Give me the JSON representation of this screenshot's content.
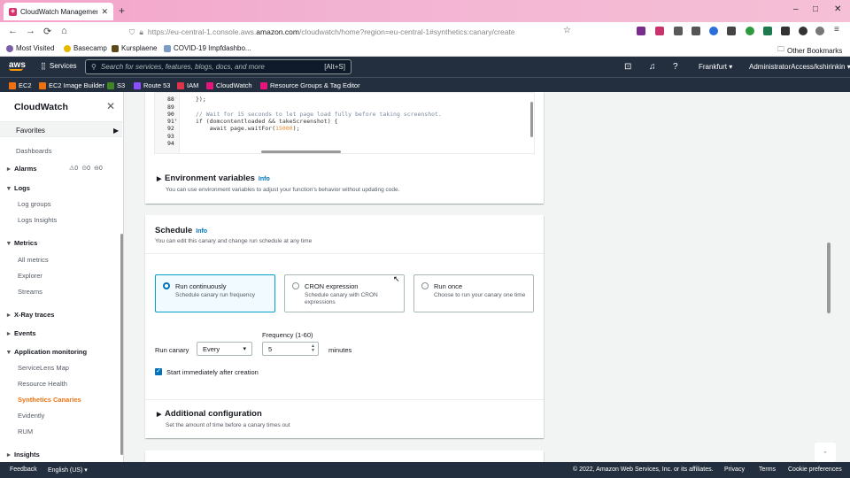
{
  "browser": {
    "tab_title": "CloudWatch Management",
    "new_tab": "+",
    "url_prefix": "https://eu-central-1.console.aws.",
    "url_host": "amazon.com",
    "url_path": "/cloudwatch/home?region=eu-central-1#synthetics:canary/create",
    "bookmarks": [
      "Most Visited",
      "Basecamp",
      "Kursplaene",
      "COVID-19 Impfdashbo..."
    ],
    "other_bookmarks": "Other Bookmarks"
  },
  "aws_header": {
    "logo": "aws",
    "services": "Services",
    "search_placeholder": "Search for services, features, blogs, docs, and more",
    "search_shortcut": "[Alt+S]",
    "region": "Frankfurt",
    "account": "AdministratorAccess/kshirinkin"
  },
  "favorites_bar": [
    "EC2",
    "EC2 Image Builder",
    "S3",
    "Route 53",
    "IAM",
    "CloudWatch",
    "Resource Groups & Tag Editor"
  ],
  "favorites_colors": [
    "#ec7211",
    "#ec7211",
    "#3f8624",
    "#8c4fff",
    "#dd344c",
    "#e7157b",
    "#e7157b"
  ],
  "sidebar": {
    "title": "CloudWatch",
    "favorites": "Favorites",
    "dashboards": "Dashboards",
    "alarms": "Alarms",
    "alarm_counts": [
      "0",
      "0",
      "0"
    ],
    "logs": "Logs",
    "log_groups": "Log groups",
    "logs_insights": "Logs Insights",
    "metrics": "Metrics",
    "all_metrics": "All metrics",
    "explorer": "Explorer",
    "streams": "Streams",
    "xray": "X-Ray traces",
    "events": "Events",
    "app_monitoring": "Application monitoring",
    "servicelens": "ServiceLens Map",
    "resource_health": "Resource Health",
    "synthetics": "Synthetics Canaries",
    "evidently": "Evidently",
    "rum": "RUM",
    "insights": "Insights"
  },
  "code": {
    "lines": [
      {
        "n": "88",
        "t": "});"
      },
      {
        "n": "89",
        "t": ""
      },
      {
        "n": "90",
        "t": "// Wait for 15 seconds to let page load fully before taking screenshot."
      },
      {
        "n": "91",
        "t": "if (domcontentloaded && takeScreenshot) {"
      },
      {
        "n": "92",
        "t": "    await page.waitFor(",
        "num": "15000",
        "tail": ");"
      },
      {
        "n": "93",
        "t": ""
      },
      {
        "n": "94",
        "t": ""
      }
    ]
  },
  "env": {
    "title": "Environment variables",
    "info": "Info",
    "desc": "You can use environment variables to adjust your function's behavior without updating code."
  },
  "schedule": {
    "title": "Schedule",
    "info": "Info",
    "desc": "You can edit this canary and change run schedule at any time",
    "options": [
      {
        "label": "Run continuously",
        "desc": "Schedule canary run frequency",
        "selected": true
      },
      {
        "label": "CRON expression",
        "desc": "Schedule canary with CRON expressions",
        "selected": false
      },
      {
        "label": "Run once",
        "desc": "Choose to run your canary one time",
        "selected": false
      }
    ],
    "run_canary_label": "Run canary",
    "run_canary_value": "Every",
    "frequency_label": "Frequency (1-60)",
    "frequency_value": "5",
    "unit": "minutes",
    "start_immediately": "Start immediately after creation",
    "start_immediately_checked": true
  },
  "additional": {
    "title": "Additional configuration",
    "desc": "Set the amount of time before a canary times out"
  },
  "footer": {
    "feedback": "Feedback",
    "language": "English (US)",
    "copyright": "© 2022, Amazon Web Services, Inc. or its affiliates.",
    "privacy": "Privacy",
    "terms": "Terms",
    "cookies": "Cookie preferences"
  },
  "colors": {
    "aws_dark": "#232f3e",
    "accent_orange": "#ec7211",
    "link_blue": "#0073bb"
  }
}
